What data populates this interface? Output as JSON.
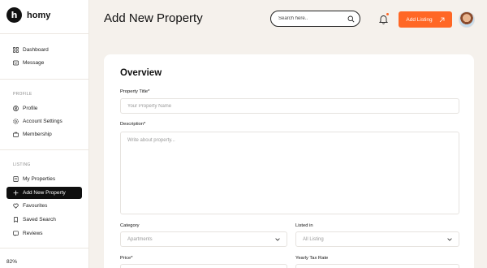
{
  "brand": {
    "name": "homy",
    "logo_letter": "h"
  },
  "sidebar": {
    "top_items": [
      {
        "label": "Dashboard",
        "icon": "grid-icon"
      },
      {
        "label": "Message",
        "icon": "message-icon"
      }
    ],
    "profile_section": "PROFILE",
    "profile_items": [
      {
        "label": "Profile",
        "icon": "user-icon"
      },
      {
        "label": "Account Settings",
        "icon": "settings-icon"
      },
      {
        "label": "Membership",
        "icon": "briefcase-icon"
      }
    ],
    "listing_section": "LISTING",
    "listing_items": [
      {
        "label": "My Properties",
        "icon": "document-icon"
      },
      {
        "label": "Add New Property",
        "icon": "plus-icon",
        "active": true
      },
      {
        "label": "Favourites",
        "icon": "heart-icon"
      },
      {
        "label": "Saved Search",
        "icon": "bookmark-icon"
      },
      {
        "label": "Reviews",
        "icon": "star-icon"
      }
    ],
    "progress": "82%"
  },
  "header": {
    "title": "Add New Property",
    "search_placeholder": "Search here..",
    "add_listing_label": "Add Listing"
  },
  "form": {
    "section_title": "Overview",
    "property_title": {
      "label": "Property Title*",
      "placeholder": "Your Property Name"
    },
    "description": {
      "label": "Description*",
      "placeholder": "Write about property..."
    },
    "category": {
      "label": "Category",
      "value": "Apartments"
    },
    "listed_in": {
      "label": "Listed in",
      "value": "All Listing"
    },
    "price": {
      "label": "Price*"
    },
    "yearly_tax_rate": {
      "label": "Yearly Tax Rate"
    }
  },
  "colors": {
    "accent": "#ff6725",
    "background": "#f5f1ec",
    "active_nav": "#0f0f0f"
  }
}
